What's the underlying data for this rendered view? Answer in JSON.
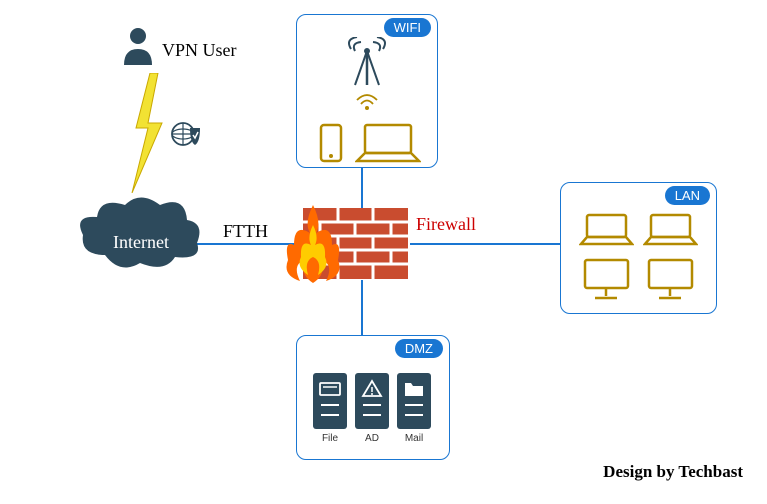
{
  "labels": {
    "vpn_user": "VPN User",
    "internet": "Internet",
    "ftth": "FTTH",
    "firewall": "Firewall",
    "credit": "Design by Techbast"
  },
  "zones": {
    "wifi": {
      "tag": "WIFI"
    },
    "lan": {
      "tag": "LAN"
    },
    "dmz": {
      "tag": "DMZ",
      "servers": {
        "file": "File",
        "ad": "AD",
        "mail": "Mail"
      }
    }
  },
  "colors": {
    "zone_border": "#1976d2",
    "tag_bg": "#1976d2",
    "device_gold": "#b38a00",
    "server_bg": "#2d4a5c",
    "cloud": "#2d4a5c",
    "firewall_label": "#cc0000",
    "flame_orange": "#ff6a00",
    "flame_yellow": "#ffcc00",
    "brick": "#c94c2f",
    "lightning": "#f2e233"
  }
}
